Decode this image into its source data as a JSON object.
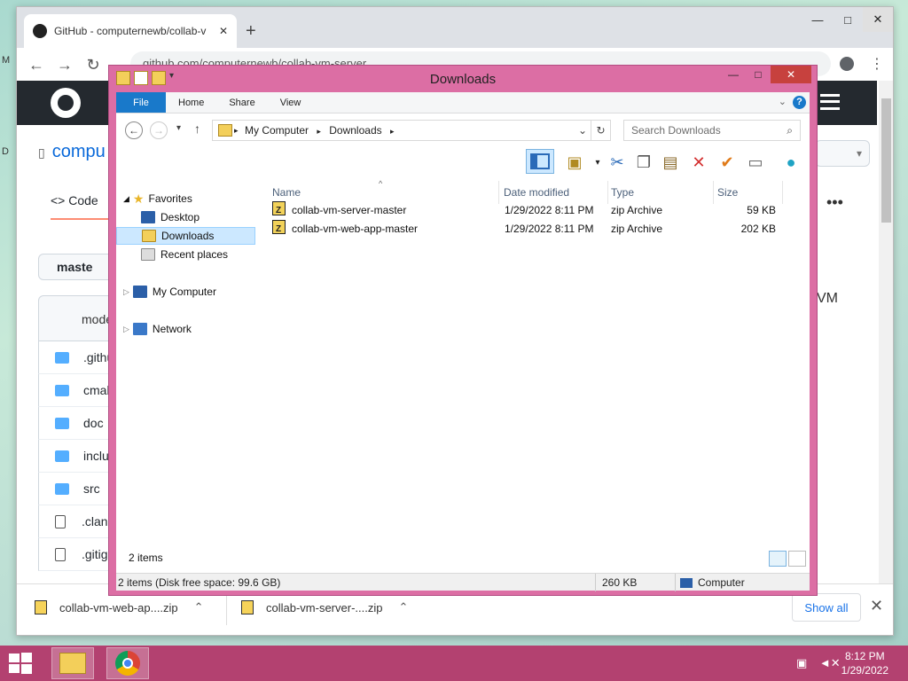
{
  "desktop": {
    "labels": [
      "M",
      "D"
    ]
  },
  "browser": {
    "tab_title": "GitHub - computernewb/collab-v",
    "new_tab": "+",
    "address": "github.com/computernewb/collab-vm-server",
    "repo_name": "compu",
    "code_tab": "Code",
    "branch": "maste",
    "commit_text": "mode",
    "vm_text": "VM",
    "files": [
      {
        "name": ".githu",
        "type": "folder"
      },
      {
        "name": "cmak",
        "type": "folder"
      },
      {
        "name": "doc",
        "type": "folder"
      },
      {
        "name": "inclu",
        "type": "folder"
      },
      {
        "name": "src",
        "type": "folder"
      },
      {
        "name": ".clang",
        "type": "file"
      },
      {
        "name": ".gitig",
        "type": "file"
      }
    ],
    "downloads": [
      {
        "name": "collab-vm-web-ap....zip"
      },
      {
        "name": "collab-vm-server-....zip"
      }
    ],
    "show_all": "Show all"
  },
  "explorer": {
    "title": "Downloads",
    "ribbon_tabs": [
      "File",
      "Home",
      "Share",
      "View"
    ],
    "breadcrumb": [
      "My Computer",
      "Downloads"
    ],
    "search_placeholder": "Search Downloads",
    "nav": {
      "favorites": "Favorites",
      "desktop": "Desktop",
      "downloads": "Downloads",
      "recent": "Recent places",
      "computer": "My Computer",
      "network": "Network"
    },
    "columns": {
      "name": "Name",
      "date": "Date modified",
      "type": "Type",
      "size": "Size"
    },
    "files": [
      {
        "name": "collab-vm-server-master",
        "date": "1/29/2022 8:11 PM",
        "type": "zip Archive",
        "size": "59 KB"
      },
      {
        "name": "collab-vm-web-app-master",
        "date": "1/29/2022 8:11 PM",
        "type": "zip Archive",
        "size": "202 KB"
      }
    ],
    "item_count": "2 items",
    "status": {
      "free": "2 items (Disk free space: 99.6 GB)",
      "size": "260 KB",
      "location": "Computer"
    }
  },
  "taskbar": {
    "time": "8:12 PM",
    "date": "1/29/2022"
  },
  "colors": {
    "window_frame": "#dc6ea4",
    "taskbar": "#b34170",
    "accent": "#1979ca"
  }
}
